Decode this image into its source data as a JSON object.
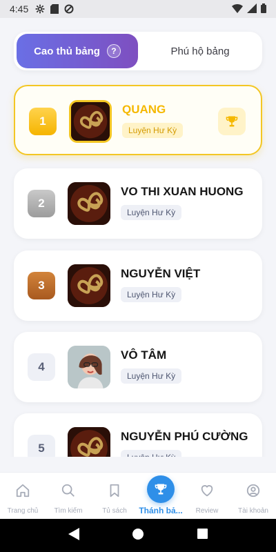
{
  "status_bar": {
    "time": "4:45"
  },
  "tabs": {
    "active_label": "Cao thủ bảng",
    "help_glyph": "?",
    "inactive_label": "Phú hộ bảng"
  },
  "ranking": [
    {
      "rank": "1",
      "name": "QUANG",
      "badge": "Luyện Hư Kỳ"
    },
    {
      "rank": "2",
      "name": "VO THI XUAN HUONG",
      "badge": "Luyện Hư Kỳ"
    },
    {
      "rank": "3",
      "name": "NGUYỄN VIỆT",
      "badge": "Luyện Hư Kỳ"
    },
    {
      "rank": "4",
      "name": "VÔ TÂM",
      "badge": "Luyện Hư Kỳ"
    },
    {
      "rank": "5",
      "name": "NGUYỄN PHÚ CƯỜNG",
      "badge": "Luyện Hư Kỳ"
    }
  ],
  "bottom_nav": {
    "home": "Trang chủ",
    "search": "Tìm kiếm",
    "bookshelf": "Tủ sách",
    "ranking": "Thánh bả...",
    "review": "Review",
    "account": "Tài khoản"
  },
  "colors": {
    "accent": "#2f8fe8",
    "gold": "#f3c623",
    "tab_gradient_start": "#6a6fe5",
    "tab_gradient_end": "#7e4fc0"
  }
}
